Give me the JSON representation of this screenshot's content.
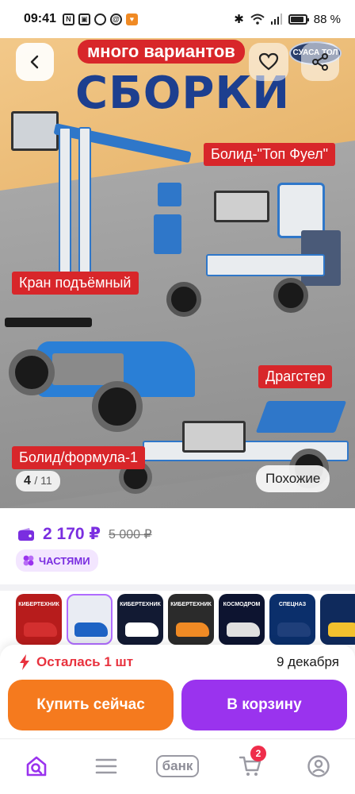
{
  "status_bar": {
    "time": "09:41",
    "battery": "88 %"
  },
  "hero": {
    "ribbon": "много вариантов",
    "title": "СБОРКИ",
    "brand": "СУАСА ТОЛ",
    "labels": {
      "bolid_top_fuel": "Болид-\"Топ Фуел\"",
      "crane": "Кран подъёмный",
      "dragster": "Драгстер",
      "formula": "Болид/формула-1"
    },
    "counter_current": "4",
    "counter_total": "/ 11",
    "similar_label": "Похожие"
  },
  "price": {
    "current": "2 170 ₽",
    "old": "5 000 ₽",
    "installment_label": "ЧАСТЯМИ"
  },
  "thumbnails": [
    {
      "label": "КИБЕРТЕХНИК",
      "color": "#b71c1c",
      "car": "#d32f2f"
    },
    {
      "label": "",
      "color": "#e9ecf3",
      "car": "#1e63c4"
    },
    {
      "label": "КИБЕРТЕХНИК",
      "color": "#121a33",
      "car": "#ffffff"
    },
    {
      "label": "КИБЕРТЕХНИК",
      "color": "#2b2b2b",
      "car": "#f08a24"
    },
    {
      "label": "КОСМОДРОМ",
      "color": "#0d1430",
      "car": "#e0e0e0"
    },
    {
      "label": "СПЕЦНАЗ",
      "color": "#0b2f6b",
      "car": "#1f3f7a"
    },
    {
      "label": "",
      "color": "#0f2a5c",
      "car": "#f2c12e"
    }
  ],
  "purchase": {
    "stock": "Осталась 1 шт",
    "delivery": "9 декабря",
    "buy_now": "Купить сейчас",
    "add_to_cart": "В корзину"
  },
  "tabbar": {
    "bank_label": "банк",
    "cart_count": "2"
  },
  "colors": {
    "accent": "#9a33ee",
    "price": "#7a2ee0",
    "buy": "#f57a1e",
    "alert": "#e8323e"
  },
  "icons": [
    "back-icon",
    "heart-icon",
    "share-icon",
    "wallet-icon",
    "installment-icon",
    "lightning-icon",
    "search-home-icon",
    "catalog-icon",
    "cart-icon",
    "profile-icon"
  ]
}
